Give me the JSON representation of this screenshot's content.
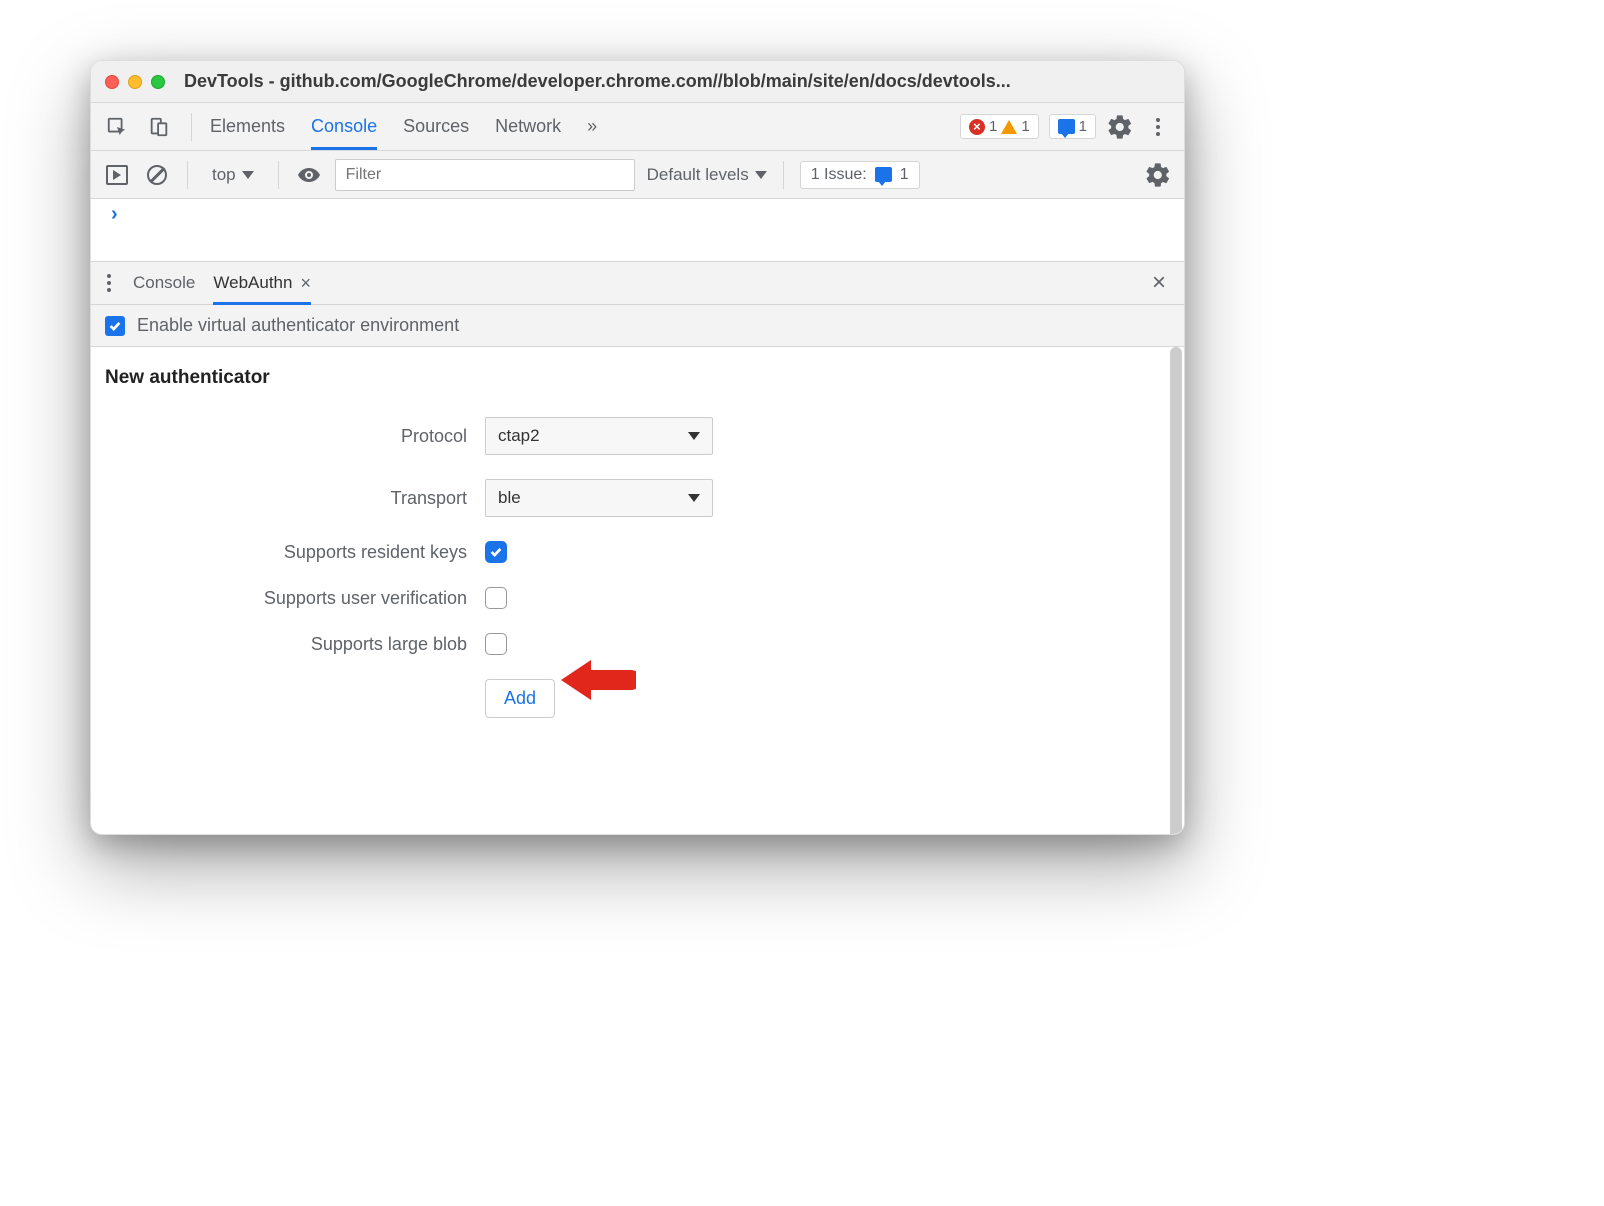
{
  "window": {
    "title": "DevTools - github.com/GoogleChrome/developer.chrome.com//blob/main/site/en/docs/devtools..."
  },
  "topbar": {
    "tabs": [
      "Elements",
      "Console",
      "Sources",
      "Network"
    ],
    "active_tab": "Console",
    "errors": "1",
    "warnings": "1",
    "issues": "1"
  },
  "consolebar": {
    "context": "top",
    "filter_placeholder": "Filter",
    "levels": "Default levels",
    "issues_label": "1 Issue:",
    "issues_count": "1"
  },
  "drawer": {
    "tabs": [
      {
        "label": "Console",
        "active": false,
        "closable": false
      },
      {
        "label": "WebAuthn",
        "active": true,
        "closable": true
      }
    ],
    "enable_label": "Enable virtual authenticator environment",
    "enable_checked": true
  },
  "webauthn": {
    "heading": "New authenticator",
    "protocol_label": "Protocol",
    "protocol_value": "ctap2",
    "transport_label": "Transport",
    "transport_value": "ble",
    "resident_label": "Supports resident keys",
    "resident_checked": true,
    "userverify_label": "Supports user verification",
    "userverify_checked": false,
    "largeblob_label": "Supports large blob",
    "largeblob_checked": false,
    "add_button": "Add"
  }
}
